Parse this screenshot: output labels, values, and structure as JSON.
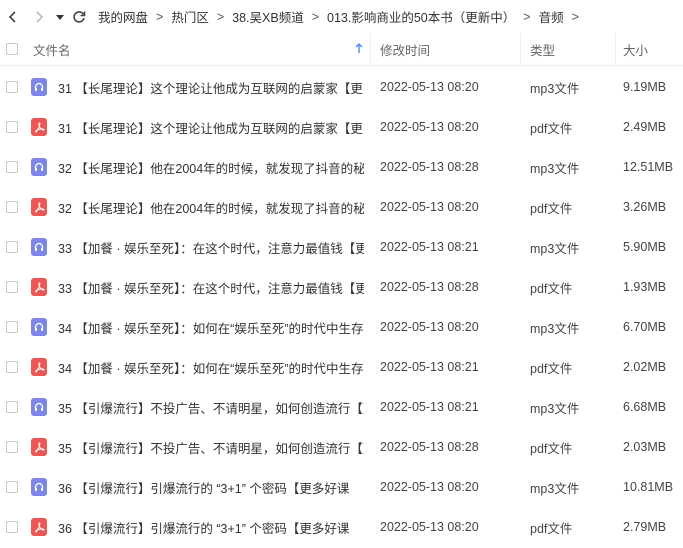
{
  "breadcrumb": [
    "我的网盘",
    "热门区",
    "38.吴XB频道",
    "013.影响商业的50本书（更新中）",
    "音频"
  ],
  "columns": {
    "name": "文件名",
    "date": "修改时间",
    "type": "类型",
    "size": "大小"
  },
  "sort": {
    "column": "name",
    "direction": "ascending"
  },
  "files": [
    {
      "icon": "audio-file-icon",
      "name": "31 【长尾理论】这个理论让他成为互联网的启蒙家【更多好课",
      "date": "2022-05-13 08:20",
      "type": "mp3文件",
      "size": "9.19MB"
    },
    {
      "icon": "pdf-file-icon",
      "name": "31 【长尾理论】这个理论让他成为互联网的启蒙家【更多好课",
      "date": "2022-05-13 08:20",
      "type": "pdf文件",
      "size": "2.49MB"
    },
    {
      "icon": "audio-file-icon",
      "name": "32 【长尾理论】他在2004年的时候，就发现了抖音的秘密【",
      "date": "2022-05-13 08:28",
      "type": "mp3文件",
      "size": "12.51MB"
    },
    {
      "icon": "pdf-file-icon",
      "name": "32 【长尾理论】他在2004年的时候，就发现了抖音的秘密【",
      "date": "2022-05-13 08:20",
      "type": "pdf文件",
      "size": "3.26MB"
    },
    {
      "icon": "audio-file-icon",
      "name": "33 【加餐 · 娱乐至死】：在这个时代，注意力最值钱【更多",
      "date": "2022-05-13 08:21",
      "type": "mp3文件",
      "size": "5.90MB"
    },
    {
      "icon": "pdf-file-icon",
      "name": "33 【加餐 · 娱乐至死】：在这个时代，注意力最值钱【更多",
      "date": "2022-05-13 08:28",
      "type": "pdf文件",
      "size": "1.93MB"
    },
    {
      "icon": "audio-file-icon",
      "name": "34 【加餐 · 娱乐至死】：如何在“娱乐至死”的时代中生存",
      "date": "2022-05-13 08:20",
      "type": "mp3文件",
      "size": "6.70MB"
    },
    {
      "icon": "pdf-file-icon",
      "name": "34 【加餐 · 娱乐至死】：如何在“娱乐至死”的时代中生存",
      "date": "2022-05-13 08:21",
      "type": "pdf文件",
      "size": "2.02MB"
    },
    {
      "icon": "audio-file-icon",
      "name": "35 【引爆流行】不投广告、不请明星，如何创造流行【更多",
      "date": "2022-05-13 08:21",
      "type": "mp3文件",
      "size": "6.68MB"
    },
    {
      "icon": "pdf-file-icon",
      "name": "35 【引爆流行】不投广告、不请明星，如何创造流行【更多",
      "date": "2022-05-13 08:28",
      "type": "pdf文件",
      "size": "2.03MB"
    },
    {
      "icon": "audio-file-icon",
      "name": "36 【引爆流行】引爆流行的 “3+1” 个密码【更多好课",
      "date": "2022-05-13 08:20",
      "type": "mp3文件",
      "size": "10.81MB"
    },
    {
      "icon": "pdf-file-icon",
      "name": "36 【引爆流行】引爆流行的 “3+1” 个密码【更多好课",
      "date": "2022-05-13 08:20",
      "type": "pdf文件",
      "size": "2.79MB"
    }
  ]
}
